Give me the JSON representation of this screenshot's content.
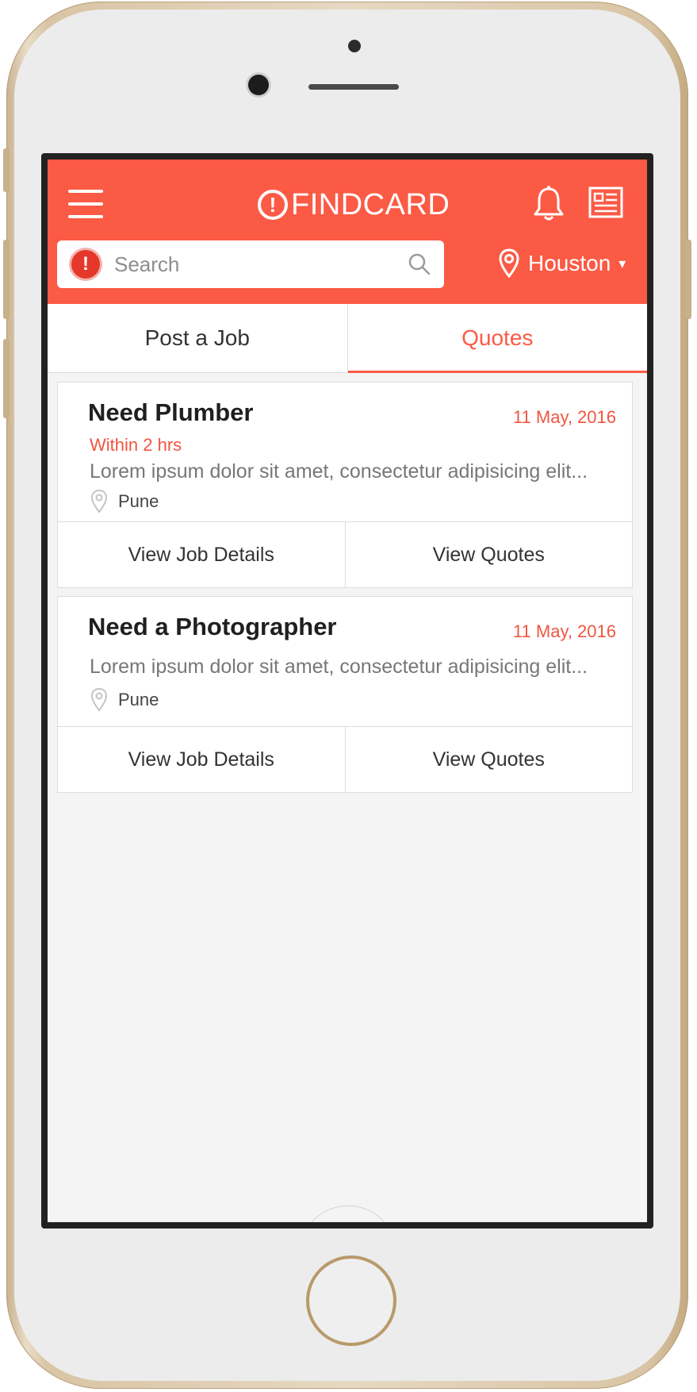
{
  "app": {
    "brand": "FINDCARD",
    "brand_mark": "!"
  },
  "header": {
    "search": {
      "placeholder": "Search"
    },
    "location": {
      "city": "Houston",
      "caret": "▾"
    }
  },
  "tabs": [
    {
      "label": "Post a Job",
      "active": false
    },
    {
      "label": "Quotes",
      "active": true
    }
  ],
  "jobs": [
    {
      "title": "Need Plumber",
      "date": "11 May, 2016",
      "urgency": "Within 2 hrs",
      "description": "Lorem ipsum dolor sit amet, consectetur adipisicing elit...",
      "location": "Pune",
      "actions": [
        "View Job Details",
        "View Quotes"
      ]
    },
    {
      "title": "Need a Photographer",
      "date": "11 May, 2016",
      "description": "Lorem ipsum dolor sit amet, consectetur adipisicing elit...",
      "location": "Pune",
      "actions": [
        "View Job Details",
        "View Quotes"
      ]
    }
  ],
  "colors": {
    "accent": "#fb5a45",
    "alert": "#e5372a",
    "background": "#f4f4f4"
  },
  "icons": [
    "menu-icon",
    "brand-logo-icon",
    "bell-icon",
    "news-icon",
    "alert-icon",
    "search-icon",
    "location-pin-icon"
  ]
}
